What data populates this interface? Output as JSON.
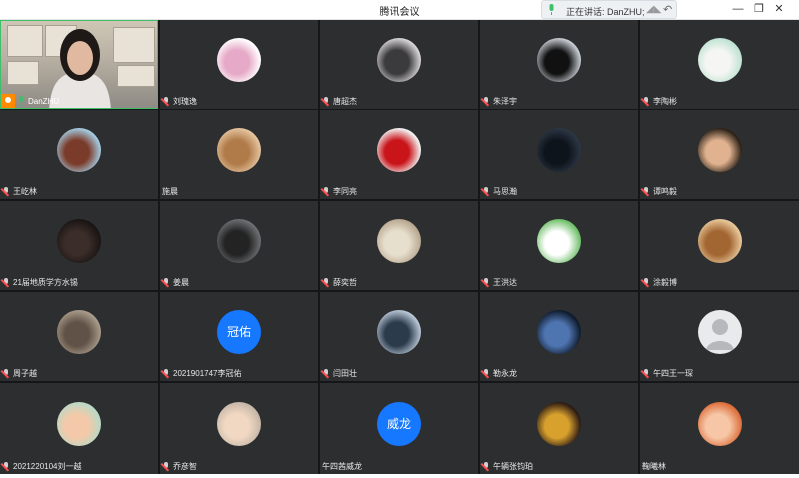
{
  "window": {
    "title": "腾讯会议",
    "speaking_label": "正在讲话: DanZHU;",
    "controls": {
      "minimize": "—",
      "restore": "❐",
      "close": "✕"
    }
  },
  "colors": {
    "tile_bg": "#2d2e30",
    "grid_bg": "#151617",
    "accent_active": "#3fbf6a",
    "text_avatar_bg": "#1677ff"
  },
  "participants": [
    {
      "name": "DanZHU",
      "type": "video",
      "host": true,
      "speaking": true
    },
    {
      "name": "刘瑰逸",
      "type": "avatar",
      "avatar_icon": "bear-sketch-avatar"
    },
    {
      "name": "唐超杰",
      "type": "avatar",
      "avatar_icon": "person-dark-avatar"
    },
    {
      "name": "朱泽宇",
      "type": "avatar",
      "avatar_icon": "dog-avatar"
    },
    {
      "name": "李陶彬",
      "type": "avatar",
      "avatar_icon": "white-bear-avatar"
    },
    {
      "name": "王屹林",
      "type": "avatar",
      "avatar_icon": "anime-girl-avatar"
    },
    {
      "name": "施晨",
      "type": "avatar",
      "avatar_icon": "cat-avatar",
      "no_mic": true
    },
    {
      "name": "李同亮",
      "type": "avatar",
      "avatar_icon": "red-black-avatar"
    },
    {
      "name": "马思瀚",
      "type": "avatar",
      "avatar_icon": "night-figure-avatar"
    },
    {
      "name": "谭鸣毅",
      "type": "avatar",
      "avatar_icon": "laughing-man-avatar"
    },
    {
      "name": "21届地质学方水锡",
      "type": "avatar",
      "avatar_icon": "dark-portrait-avatar"
    },
    {
      "name": "姜晨",
      "type": "avatar",
      "avatar_icon": "cat-gray-avatar"
    },
    {
      "name": "薛奕哲",
      "type": "avatar",
      "avatar_icon": "box-cat-avatar"
    },
    {
      "name": "王洪达",
      "type": "avatar",
      "avatar_icon": "green-drawing-avatar"
    },
    {
      "name": "涂毅博",
      "type": "avatar",
      "avatar_icon": "shiba-avatar"
    },
    {
      "name": "周子越",
      "type": "avatar",
      "avatar_icon": "gesture-avatar"
    },
    {
      "name": "2021901747李冠佑",
      "type": "text",
      "avatar_text": "冠佑"
    },
    {
      "name": "闫田壮",
      "type": "avatar",
      "avatar_icon": "basketball-avatar"
    },
    {
      "name": "勒永龙",
      "type": "avatar",
      "avatar_icon": "dark-anime-avatar"
    },
    {
      "name": "午四王一琛",
      "type": "avatar",
      "avatar_icon": "default-user-avatar"
    },
    {
      "name": "2021220104刘一越",
      "type": "avatar",
      "avatar_icon": "cartoon-avatar"
    },
    {
      "name": "乔彦智",
      "type": "avatar",
      "avatar_icon": "crying-avatar"
    },
    {
      "name": "午四茜威龙",
      "type": "text",
      "avatar_text": "威龙",
      "no_mic": true
    },
    {
      "name": "午辆张钧珀",
      "type": "avatar",
      "avatar_icon": "emblem-avatar"
    },
    {
      "name": "鞠曦林",
      "type": "avatar",
      "avatar_icon": "orange-cat-avatar",
      "no_mic": true
    }
  ]
}
